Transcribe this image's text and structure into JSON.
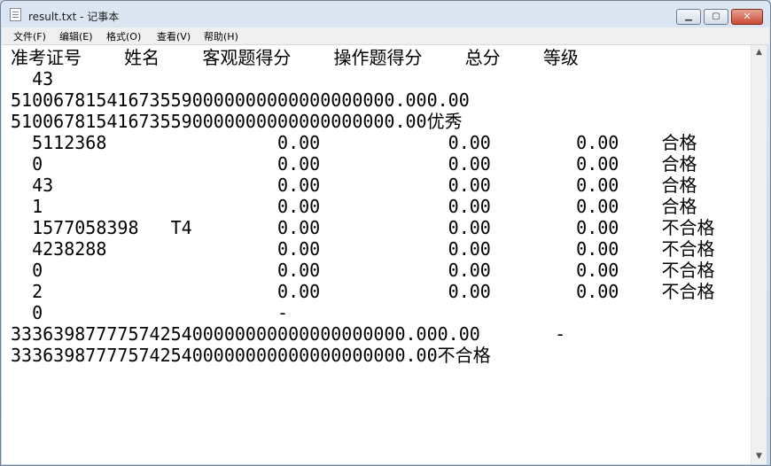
{
  "window": {
    "title": "result.txt - 记事本",
    "controls": {
      "minimize": "▁",
      "maximize": "▢",
      "close": "✕"
    }
  },
  "menu": [
    "文件(F)",
    "编辑(E)",
    "格式(O)",
    "查看(V)",
    "帮助(H)"
  ],
  "editor": {
    "lines": [
      "准考证号    姓名    客观题得分    操作题得分    总分    等级",
      "  43",
      "510067815416735590000000000000000000.000.00",
      "510067815416735590000000000000000000.00优秀",
      "  5112368                0.00            0.00        0.00    合格",
      "  0                      0.00            0.00        0.00    合格",
      "  43                     0.00            0.00        0.00    合格",
      "  1                      0.00            0.00        0.00    合格",
      "  1577058398   T4        0.00            0.00        0.00    不合格",
      "  4238288                0.00            0.00        0.00    不合格",
      "  0                      0.00            0.00        0.00    不合格",
      "  2                      0.00            0.00        0.00    不合格",
      "  0                      -",
      "3336398777757425400000000000000000000.000.00       -",
      "3336398777757425400000000000000000000.00不合格"
    ]
  },
  "scrollbar": {
    "up_arrow": "▲",
    "down_arrow": "▼"
  }
}
